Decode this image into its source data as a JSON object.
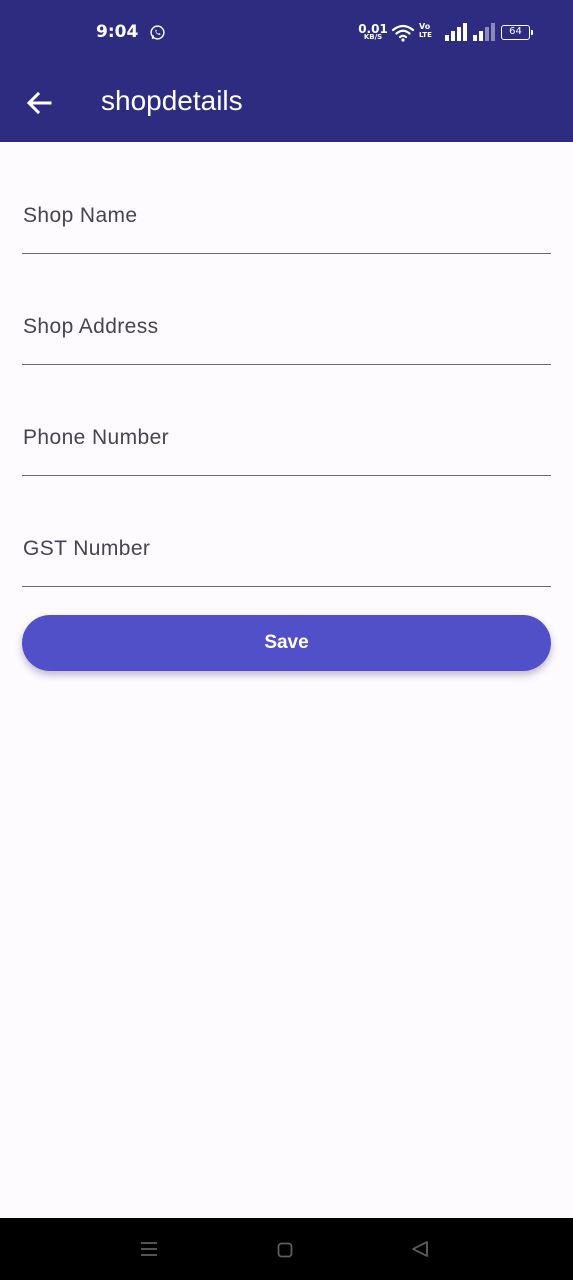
{
  "status_bar": {
    "time": "9:04",
    "network_speed_value": "0.01",
    "network_speed_unit": "KB/S",
    "volte_top": "Vo",
    "volte_bottom": "LTE",
    "battery": "64"
  },
  "app_bar": {
    "title": "shopdetails",
    "back_icon": "arrow-back-icon"
  },
  "form": {
    "fields": [
      {
        "label": "Shop Name",
        "value": ""
      },
      {
        "label": "Shop Address",
        "value": ""
      },
      {
        "label": "Phone Number",
        "value": ""
      },
      {
        "label": "GST Number",
        "value": ""
      }
    ],
    "save_label": "Save"
  },
  "nav_bar": {
    "icons": [
      "menu-icon",
      "home-icon",
      "back-triangle-icon"
    ]
  },
  "colors": {
    "app_bar": "#2d2c80",
    "button": "#5250c8",
    "background": "#fefbff",
    "nav_bar": "#000000"
  }
}
